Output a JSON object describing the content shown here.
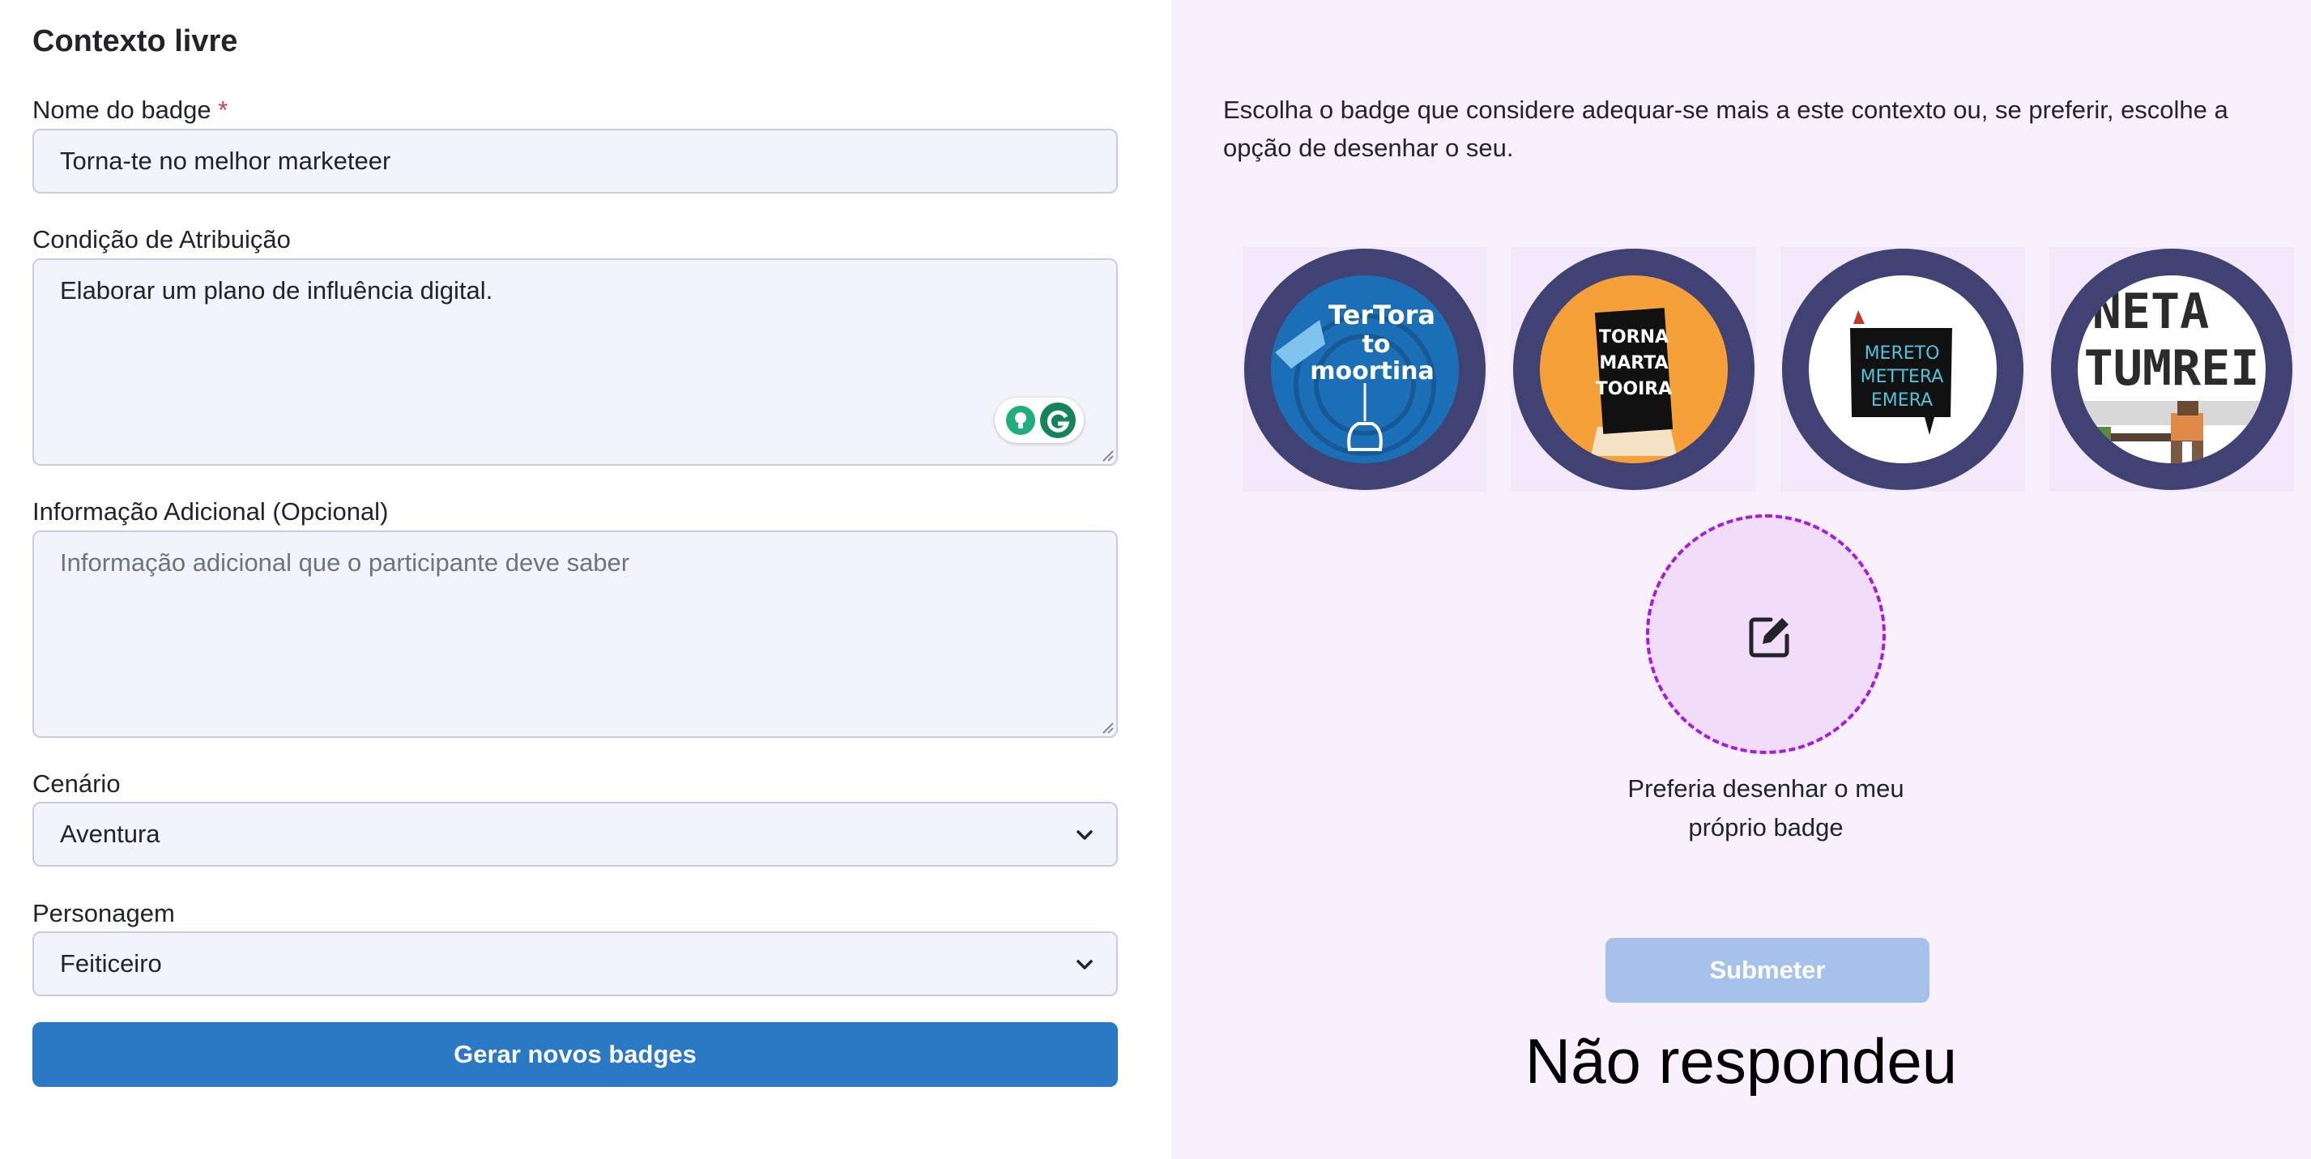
{
  "form": {
    "heading": "Contexto livre",
    "name_label": "Nome do badge",
    "required_mark": "*",
    "name_value": "Torna-te no melhor marketeer",
    "condition_label": "Condição de Atribuição",
    "condition_value": "Elaborar um plano de influência digital.",
    "info_label": "Informação Adicional (Opcional)",
    "info_placeholder": "Informação adicional que o participante deve saber",
    "scenario_label": "Cenário",
    "scenario_value": "Aventura",
    "character_label": "Personagem",
    "character_value": "Feiticeiro",
    "generate_button": "Gerar novos badges"
  },
  "panel": {
    "intro": "Escolha o badge que considere adequar-se mais a este contexto ou, se preferir, escolhe a opção de desenhar o seu.",
    "badges": [
      {
        "text_lines": [
          "TerTora",
          "to",
          "moortina"
        ],
        "bg": "#1b6fb7"
      },
      {
        "text_lines": [
          "TORNA",
          "MARTA",
          "TOOIRA"
        ],
        "bg": "#f6a03a"
      },
      {
        "text_lines": [
          "MERETO",
          "METTERA",
          "EMERA"
        ],
        "bg": "#ffffff"
      },
      {
        "text_lines": [
          "NETA",
          "TUMREI"
        ],
        "bg": "#ffffff"
      }
    ],
    "ring_color": "#3f4272",
    "draw_option_label": "Preferia desenhar o meu próprio badge",
    "submit_button": "Submeter"
  },
  "status_text": "Não respondeu",
  "colors": {
    "primary": "#2b78c5",
    "submit_disabled": "#a7c2ea",
    "draw_border": "#a31ce0",
    "panel_bg": "#f9f0fe"
  }
}
